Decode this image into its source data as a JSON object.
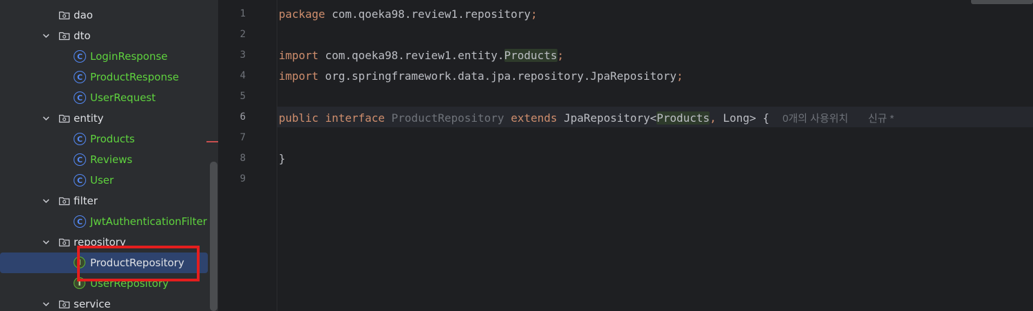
{
  "tree": {
    "items": [
      {
        "label": "dao",
        "kind": "folder",
        "expanded": false,
        "color": "white"
      },
      {
        "label": "dto",
        "kind": "folder",
        "expanded": true,
        "color": "white"
      },
      {
        "label": "LoginResponse",
        "kind": "class",
        "color": "green"
      },
      {
        "label": "ProductResponse",
        "kind": "class",
        "color": "green"
      },
      {
        "label": "UserRequest",
        "kind": "class",
        "color": "green"
      },
      {
        "label": "entity",
        "kind": "folder",
        "expanded": true,
        "color": "white"
      },
      {
        "label": "Products",
        "kind": "class",
        "color": "green"
      },
      {
        "label": "Reviews",
        "kind": "class",
        "color": "green"
      },
      {
        "label": "User",
        "kind": "class",
        "color": "green"
      },
      {
        "label": "filter",
        "kind": "folder",
        "expanded": true,
        "color": "white"
      },
      {
        "label": "JwtAuthenticationFilter",
        "kind": "class",
        "color": "green"
      },
      {
        "label": "repository",
        "kind": "folder",
        "expanded": true,
        "color": "white"
      },
      {
        "label": "ProductRepository",
        "kind": "interface",
        "color": "white",
        "selected": true
      },
      {
        "label": "UserRepository",
        "kind": "interface",
        "color": "green"
      },
      {
        "label": "service",
        "kind": "folder",
        "expanded": true,
        "color": "white"
      }
    ],
    "class_icon_letter": "C",
    "interface_icon_letter": "I"
  },
  "editor": {
    "line_numbers": [
      "1",
      "2",
      "3",
      "4",
      "5",
      "6",
      "7",
      "8",
      "9"
    ],
    "active_line": 6,
    "lines": {
      "l1": {
        "kw": "package",
        "pkg": " com.qoeka98.review1.repository",
        "semi": ";"
      },
      "l3": {
        "kw": "import",
        "pkg": " com.qoeka98.review1.entity.",
        "cls": "Products",
        "semi": ";"
      },
      "l4": {
        "kw": "import",
        "pkg": " org.springframework.data.jpa.repository.JpaRepository",
        "semi": ";"
      },
      "l6": {
        "kw1": "public",
        "kw2": "interface",
        "name": "ProductRepository",
        "kw3": "extends",
        "base": "JpaRepository<",
        "generic": "Products",
        "comma": ",",
        "rest": " Long> {",
        "hint_usages": "0개의 사용위치",
        "hint_new": "신규 *"
      },
      "l8": {
        "text": "}"
      }
    }
  },
  "colors": {
    "keyword": "#cf8e6d",
    "green_file": "#5fd33e",
    "selection": "#2e436e",
    "annotation_box": "#e41e1e"
  }
}
